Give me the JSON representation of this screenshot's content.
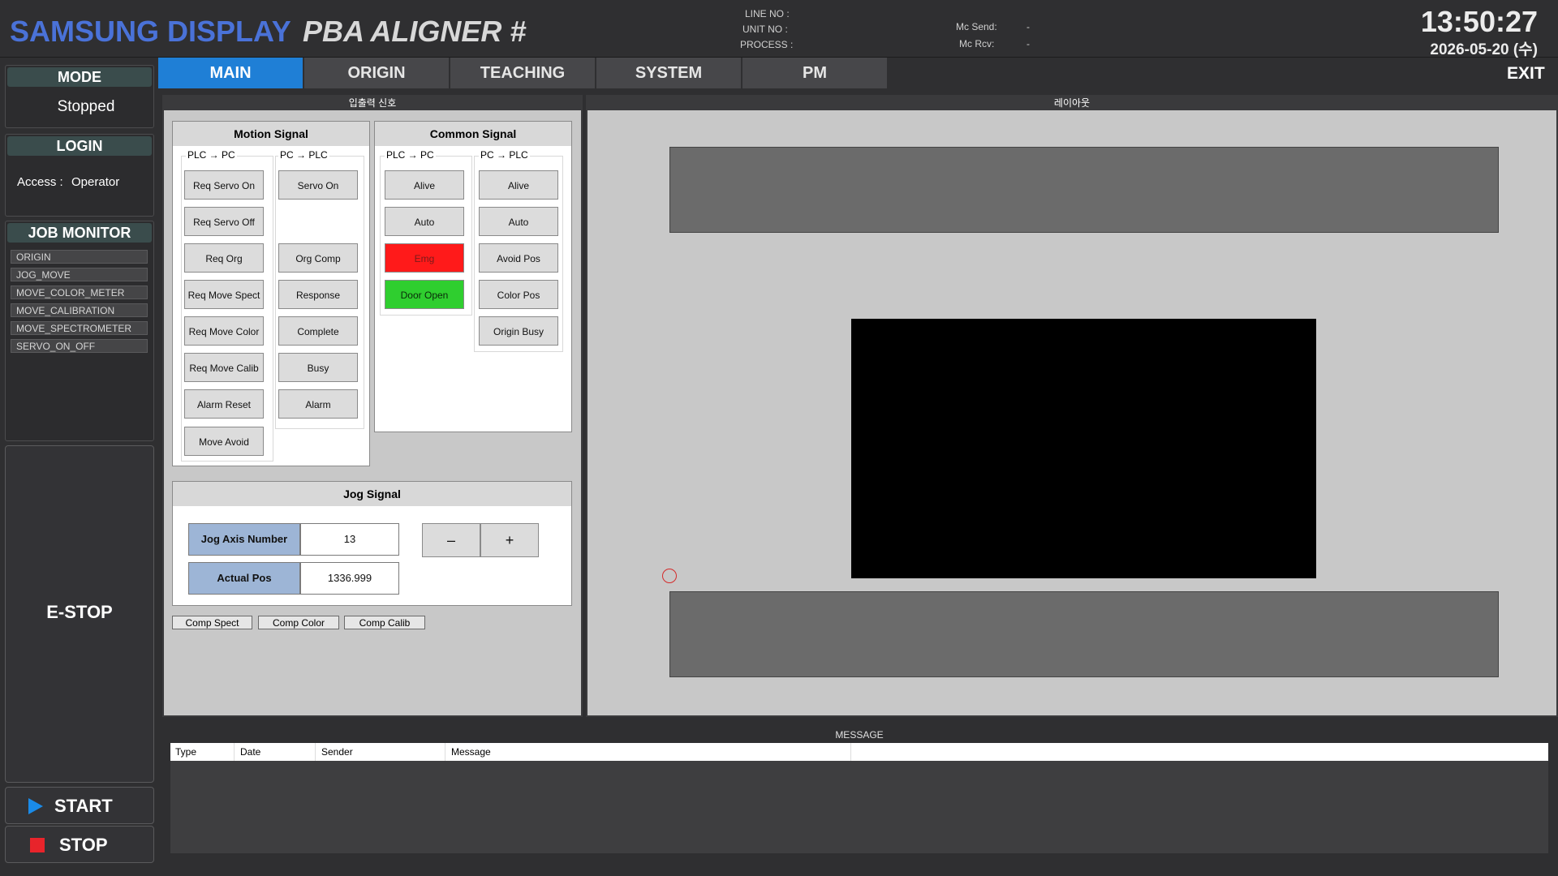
{
  "header": {
    "brand": "SAMSUNG DISPLAY",
    "product": "PBA ALIGNER #",
    "line_no_label": "LINE NO :",
    "unit_no_label": "UNIT NO :",
    "process_label": "PROCESS :",
    "mc_send_label": "Mc Send:",
    "mc_send_value": "-",
    "mc_rcv_label": "Mc Rcv:",
    "mc_rcv_value": "-",
    "time": "13:50:27",
    "date": "2026-05-20 (수)"
  },
  "left": {
    "mode_title": "MODE",
    "mode_value": "Stopped",
    "login_title": "LOGIN",
    "access_label": "Access :",
    "access_value": "Operator",
    "job_title": "JOB MONITOR",
    "jobs": [
      "ORIGIN",
      "JOG_MOVE",
      "MOVE_COLOR_METER",
      "MOVE_CALIBRATION",
      "MOVE_SPECTROMETER",
      "SERVO_ON_OFF"
    ],
    "estop": "E-STOP",
    "start": "START",
    "stop": "STOP"
  },
  "tabs": [
    "MAIN",
    "ORIGIN",
    "TEACHING",
    "SYSTEM",
    "PM"
  ],
  "exit": "EXIT",
  "io_panel": {
    "title": "입출력 신호",
    "motion": {
      "title": "Motion Signal",
      "col1_label": "PLC → PC",
      "col1": [
        "Req Servo On",
        "Req Servo Off",
        "Req Org",
        "Req Move Spect",
        "Req Move Color",
        "Req Move Calib",
        "Alarm Reset",
        "Move Avoid"
      ],
      "col2_label": "PC → PLC",
      "col2": [
        "Servo On",
        "Org Comp",
        "Response",
        "Complete",
        "Busy",
        "Alarm"
      ]
    },
    "common": {
      "title": "Common Signal",
      "col1_label": "PLC → PC",
      "col1": [
        "Alive",
        "Auto",
        "Emg",
        "Door Open"
      ],
      "col2_label": "PC → PLC",
      "col2": [
        "Alive",
        "Auto",
        "Avoid Pos",
        "Color Pos",
        "Origin Busy"
      ]
    },
    "jog": {
      "title": "Jog Signal",
      "axis_label": "Jog Axis Number",
      "axis_value": "13",
      "pos_label": "Actual Pos",
      "pos_value": "1336.999",
      "minus": "–",
      "plus": "+"
    },
    "comp_buttons": [
      "Comp Spect",
      "Comp Color",
      "Comp Calib"
    ]
  },
  "layout_panel": {
    "title": "레이아웃"
  },
  "message": {
    "title": "MESSAGE",
    "columns": [
      "Type",
      "Date",
      "Sender",
      "Message"
    ]
  },
  "colors": {
    "accent": "#1f7fd6",
    "brand": "#4a72d8",
    "emg": "#ff1a1a",
    "door_open": "#2fce2f"
  }
}
